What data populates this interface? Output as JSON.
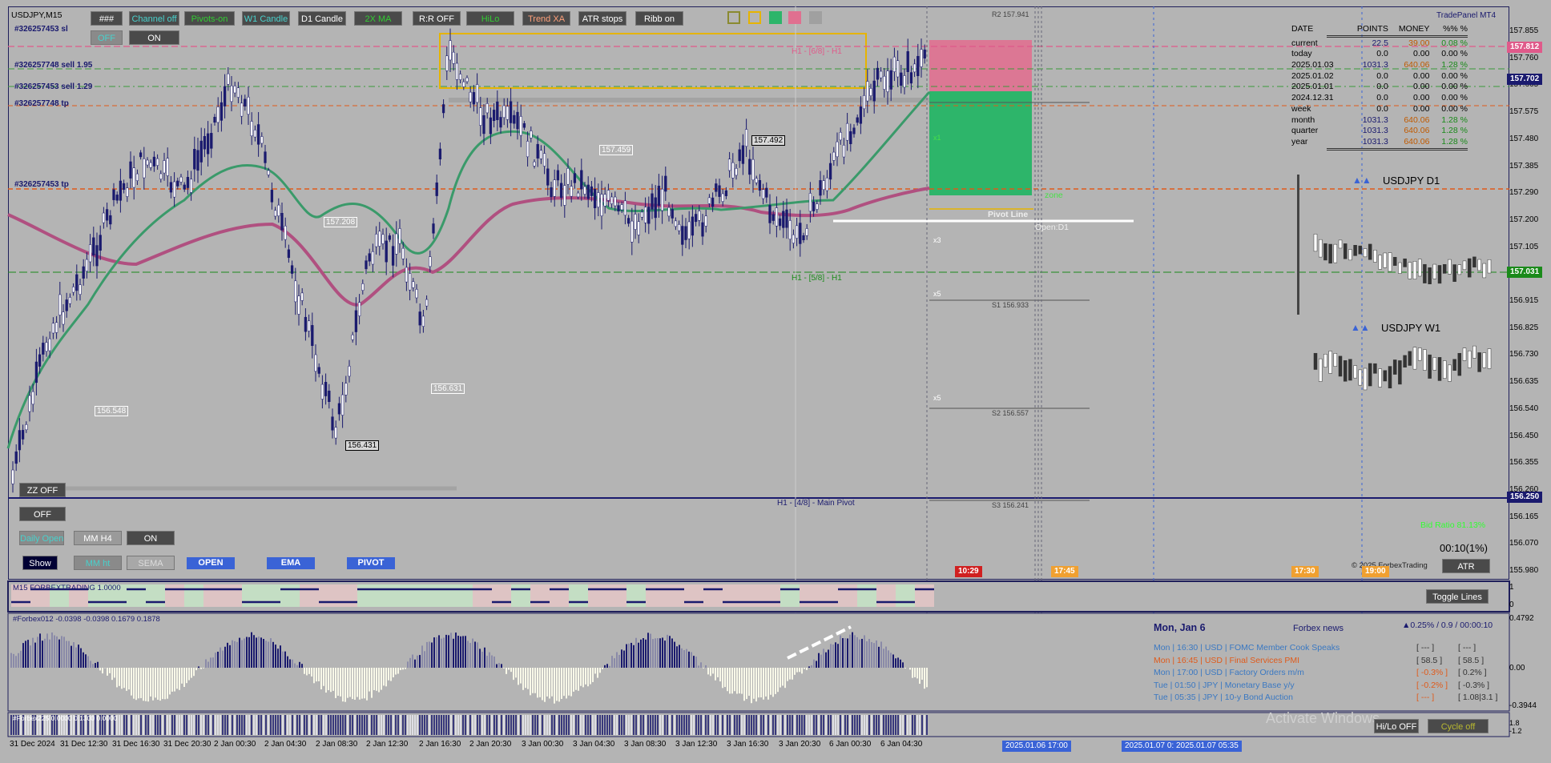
{
  "symbol": "USDJPY,M15",
  "brand": "TradePanel MT4",
  "toolbar": {
    "b1": "###",
    "b2": "Channel off",
    "b3": "Pivots-on",
    "b4": "W1 Candle",
    "b5": "D1 Candle",
    "b6": "2X MA",
    "b7": "R:R OFF",
    "b8": "HiLo",
    "b9": "Trend XA",
    "b10": "ATR stops",
    "b11": "Ribb on",
    "off": "OFF",
    "on": "ON"
  },
  "order_labels": {
    "l1": "#326257453 sl",
    "l2": "#326257748 sell 1.95",
    "l3": "#326257453 sell 1.29",
    "l4": "#326257748 tp",
    "l5": "#326257453 tp"
  },
  "left_panel": {
    "zz": "ZZ OFF",
    "off": "OFF",
    "daily_open": "Daily Open",
    "mm_h4": "MM H4",
    "on": "ON",
    "show": "Show",
    "mm_ht": "MM ht",
    "sema": "SEMA",
    "open": "OPEN",
    "ema": "EMA",
    "pivot": "PIVOT"
  },
  "chart_labels": {
    "r2": "R2 157.941",
    "s1": "S1 156.933",
    "s2": "S2 156.557",
    "s3": "S3 156.241",
    "h1_68": "H1 - [6/8] - H1",
    "h1_58": "H1 - [5/8] - H1",
    "h1_48": "H1 - [4/8] - Main Pivot",
    "pivot_line": "Pivot Line",
    "open_d1": "Open:D1",
    "zone": "zone",
    "p1": "157.492",
    "p2": "157.459",
    "p3": "157.208",
    "p4": "156.631",
    "p5": "156.548",
    "p6": "156.431",
    "x1": "x1",
    "x3": "x3",
    "x5": "x5",
    "x5b": "x5"
  },
  "price_axis": [
    "157.855",
    "157.760",
    "157.665",
    "157.575",
    "157.480",
    "157.385",
    "157.290",
    "157.200",
    "157.105",
    "157.010",
    "156.915",
    "156.825",
    "156.730",
    "156.635",
    "156.540",
    "156.450",
    "156.355",
    "156.260",
    "156.165",
    "156.070",
    "155.980"
  ],
  "price_tags": {
    "t1": "157.812",
    "t2": "157.702",
    "t3": "157.031",
    "t4": "156.250"
  },
  "stats": {
    "headers": [
      "DATE",
      "POINTS",
      "MONEY",
      "%%  %"
    ],
    "rows": [
      [
        "current",
        "22.5",
        "39.00",
        "0.08  %"
      ],
      [
        "today",
        "0.0",
        "0.00",
        "0.00  %"
      ],
      [
        "2025.01.03",
        "1031.3",
        "640.06",
        "1.28  %"
      ],
      [
        "2025.01.02",
        "0.0",
        "0.00",
        "0.00  %"
      ],
      [
        "2025.01.01",
        "0.0",
        "0.00",
        "0.00  %"
      ],
      [
        "2024.12.31",
        "0.0",
        "0.00",
        "0.00  %"
      ],
      [
        "week",
        "0.0",
        "0.00",
        "0.00  %"
      ],
      [
        "month",
        "1031.3",
        "640.06",
        "1.28  %"
      ],
      [
        "quarter",
        "1031.3",
        "640.06",
        "1.28  %"
      ],
      [
        "year",
        "1031.3",
        "640.06",
        "1.28  %"
      ]
    ]
  },
  "mini": {
    "d1": "USDJPY  D1",
    "w1": "USDJPY  W1"
  },
  "info": {
    "bid_ratio": "Bid Ratio 81.13%",
    "timer": "00:10(1%)",
    "copyright": "© 2025 ForbexTrading",
    "atr": "ATR",
    "toggle": "Toggle Lines"
  },
  "time_tags": {
    "t1": "10:29",
    "t2": "17:45",
    "t3": "17:30",
    "t4": "19:00"
  },
  "sub1": {
    "title": "M15 FORBEXTRADING 1.0000",
    "y1": "1",
    "y0": "0"
  },
  "sub2": {
    "title": "#Forbex012 -0.0398 -0.0398 0.1679 0.1878",
    "y1": "0.4792",
    "y0": "0.00",
    "y2": "-0.3944"
  },
  "sub3": {
    "title": "#Forbex225 0.0000 0.1300 0.0000",
    "y1": "1.8",
    "y2": "-1.2"
  },
  "news": {
    "date": "Mon, Jan 6",
    "title": "Forbex news",
    "stat": "▲0.25% / 0.9 / 00:00:10",
    "rows": [
      {
        "t": "Mon  |  16:30  |  USD  |  FOMC Member Cook Speaks",
        "a": "[ --- ]",
        "b": "[ --- ]",
        "c": "#3a78c2",
        "ac": "#333"
      },
      {
        "t": "Mon  |  16:45  |  USD  |  Final Services PMI",
        "a": "[ 58.5 ]",
        "b": "[ 58.5 ]",
        "c": "#e05a1a",
        "ac": "#333"
      },
      {
        "t": "Mon  |  17:00  |  USD  |  Factory Orders m/m",
        "a": "[ -0.3% ]",
        "b": "[ 0.2% ]",
        "c": "#3a78c2",
        "ac": "#e05a1a"
      },
      {
        "t": "Tue  |  01:50  |  JPY  |  Monetary Base y/y",
        "a": "[ -0.2% ]",
        "b": "[ -0.3% ]",
        "c": "#3a78c2",
        "ac": "#e05a1a"
      },
      {
        "t": "Tue  |  05:35  |  JPY  |  10-y Bond Auction",
        "a": "[ --- ]",
        "b": "[ 1.08|3.1 ]",
        "c": "#3a78c2",
        "ac": "#e05a1a"
      }
    ]
  },
  "bottom": {
    "hilo": "Hi/Lo OFF",
    "cycle": "Cycle off",
    "activate": "Activate Windows",
    "d1": "2025.01.06 17:00",
    "d2": "2025.01.07 0: 2025.01.07 05:35"
  },
  "time_axis": [
    "31 Dec 2024",
    "31 Dec 12:30",
    "31 Dec 16:30",
    "31 Dec 20:30",
    "2 Jan 00:30",
    "2 Jan 04:30",
    "2 Jan 08:30",
    "2 Jan 12:30",
    "2 Jan 16:30",
    "2 Jan 20:30",
    "3 Jan 00:30",
    "3 Jan 04:30",
    "3 Jan 08:30",
    "3 Jan 12:30",
    "3 Jan 16:30",
    "3 Jan 20:30",
    "6 Jan 00:30",
    "6 Jan 04:30"
  ],
  "colors": {
    "bg": "#b4b4b4",
    "candle": "#1a1a6e",
    "sell_zone": "#e07090",
    "tp_zone": "#2db56a",
    "ma_green": "#3a9a6a",
    "ma_pink": "#b05080"
  }
}
